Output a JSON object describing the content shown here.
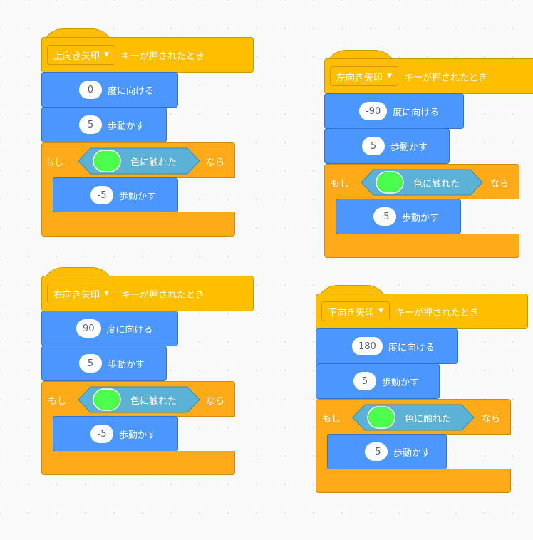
{
  "colors": {
    "events": "#ffbf00",
    "motion": "#4c97ff",
    "control": "#ffab19",
    "sensing": "#5cb1d6",
    "touch_color": "#4cff4c"
  },
  "scripts": [
    {
      "key_option": "上向き矢印",
      "hat_label": "キーが押されたとき",
      "direction_value": "0",
      "direction_label": "度に向ける",
      "move_value": "5",
      "move_label": "歩動かす",
      "if_label": "もし",
      "touching_label": "色に触れた",
      "then_label": "なら",
      "inner_move_value": "-5",
      "inner_move_label": "歩動かす"
    },
    {
      "key_option": "左向き矢印",
      "hat_label": "キーが押されたとき",
      "direction_value": "-90",
      "direction_label": "度に向ける",
      "move_value": "5",
      "move_label": "歩動かす",
      "if_label": "もし",
      "touching_label": "色に触れた",
      "then_label": "なら",
      "inner_move_value": "-5",
      "inner_move_label": "歩動かす"
    },
    {
      "key_option": "右向き矢印",
      "hat_label": "キーが押されたとき",
      "direction_value": "90",
      "direction_label": "度に向ける",
      "move_value": "5",
      "move_label": "歩動かす",
      "if_label": "もし",
      "touching_label": "色に触れた",
      "then_label": "なら",
      "inner_move_value": "-5",
      "inner_move_label": "歩動かす"
    },
    {
      "key_option": "下向き矢印",
      "hat_label": "キーが押されたとき",
      "direction_value": "180",
      "direction_label": "度に向ける",
      "move_value": "5",
      "move_label": "歩動かす",
      "if_label": "もし",
      "touching_label": "色に触れた",
      "then_label": "なら",
      "inner_move_value": "-5",
      "inner_move_label": "歩動かす"
    }
  ]
}
